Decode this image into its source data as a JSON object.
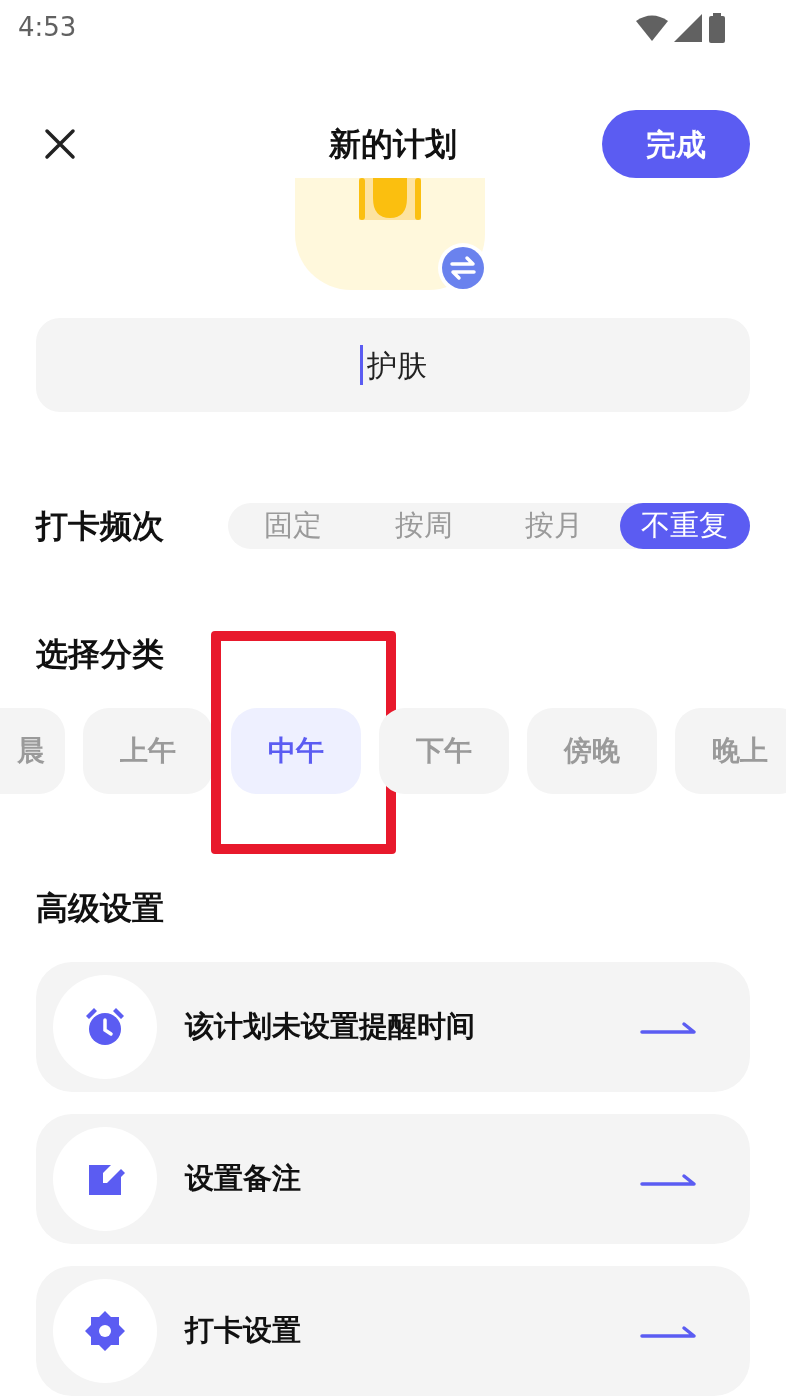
{
  "status_bar": {
    "time": "4:53"
  },
  "header": {
    "title": "新的计划",
    "done_button": "完成"
  },
  "name_field": {
    "value": "护肤"
  },
  "frequency": {
    "label": "打卡频次",
    "options": [
      {
        "label": "固定",
        "selected": false
      },
      {
        "label": "按周",
        "selected": false
      },
      {
        "label": "按月",
        "selected": false
      },
      {
        "label": "不重复",
        "selected": true
      }
    ]
  },
  "category": {
    "label": "选择分类",
    "options": [
      {
        "label": "晨",
        "selected": false,
        "highlighted": false
      },
      {
        "label": "上午",
        "selected": false,
        "highlighted": false
      },
      {
        "label": "中午",
        "selected": true,
        "highlighted": true
      },
      {
        "label": "下午",
        "selected": false,
        "highlighted": false
      },
      {
        "label": "傍晚",
        "selected": false,
        "highlighted": false
      },
      {
        "label": "晚上",
        "selected": false,
        "highlighted": false
      }
    ]
  },
  "advanced": {
    "label": "高级设置",
    "items": [
      {
        "kind": "reminder",
        "label": "该计划未设置提醒时间"
      },
      {
        "kind": "note",
        "label": "设置备注"
      },
      {
        "kind": "checkin",
        "label": "打卡设置"
      }
    ]
  }
}
